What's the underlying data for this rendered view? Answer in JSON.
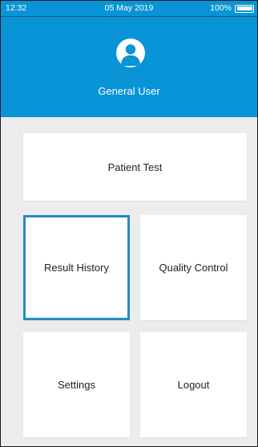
{
  "status_bar": {
    "time": "12:32",
    "date": "05 May 2019",
    "battery": "100%"
  },
  "header": {
    "user_name": "General User",
    "avatar_icon": "user-avatar-icon"
  },
  "menu": {
    "patient_test": "Patient Test",
    "result_history": "Result History",
    "quality_control": "Quality Control",
    "settings": "Settings",
    "logout": "Logout",
    "selected": "result_history"
  },
  "colors": {
    "primary": "#0894d6",
    "selected_border": "#1f8cc4",
    "background": "#ececec"
  }
}
